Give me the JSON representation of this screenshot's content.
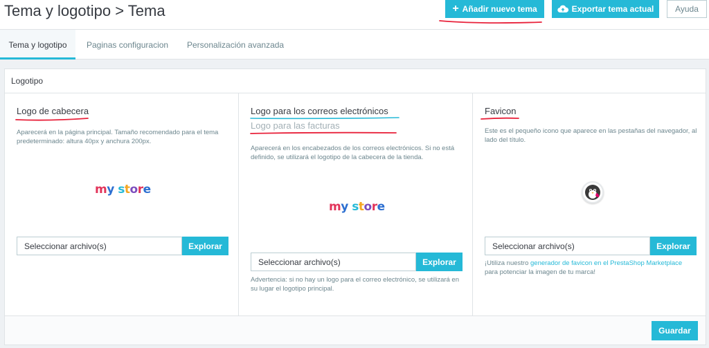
{
  "header": {
    "title": "Tema y logotipo > Tema",
    "add_theme_label": "Añadir nuevo tema",
    "export_theme_label": "Exportar tema actual",
    "help_label": "Ayuda"
  },
  "tabs": [
    {
      "label": "Tema y logotipo",
      "active": true
    },
    {
      "label": "Paginas configuracion",
      "active": false
    },
    {
      "label": "Personalización avanzada",
      "active": false
    }
  ],
  "panel": {
    "heading": "Logotipo",
    "save_label": "Guardar"
  },
  "columns": {
    "header_logo": {
      "title": "Logo de cabecera",
      "description": "Aparecerá en la página principal. Tamaño recomendado para el tema predeterminado: altura 40px y anchura 200px.",
      "logo_text": "my store",
      "file_placeholder": "Seleccionar archivo(s)",
      "browse_label": "Explorar"
    },
    "email_logo": {
      "title": "Logo para los correos electrónicos",
      "subtitle": "Logo para las facturas",
      "description": "Aparecerá en los encabezados de los correos electrónicos. Si no está definido, se utilizará el logotipo de la cabecera de la tienda.",
      "logo_text": "my store",
      "file_placeholder": "Seleccionar archivo(s)",
      "browse_label": "Explorar",
      "warning": "Advertencia: si no hay un logo para el correo electrónico, se utilizará en su lugar el logotipo principal."
    },
    "favicon": {
      "title": "Favicon",
      "description": "Este es el pequeño icono que aparece en las pestañas del navegador, al lado del título.",
      "file_placeholder": "Seleccionar archivo(s)",
      "browse_label": "Explorar",
      "note_prefix": "¡Utiliza nuestro ",
      "note_link": "generador de favicon en el PrestaShop Marketplace",
      "note_suffix": "para potenciar la imagen de tu marca!"
    }
  },
  "colors": {
    "accent": "#25b9d7",
    "annotation": "#e8213a"
  },
  "icons": [
    "plus-icon",
    "cloud-upload-icon",
    "favicon-image"
  ]
}
